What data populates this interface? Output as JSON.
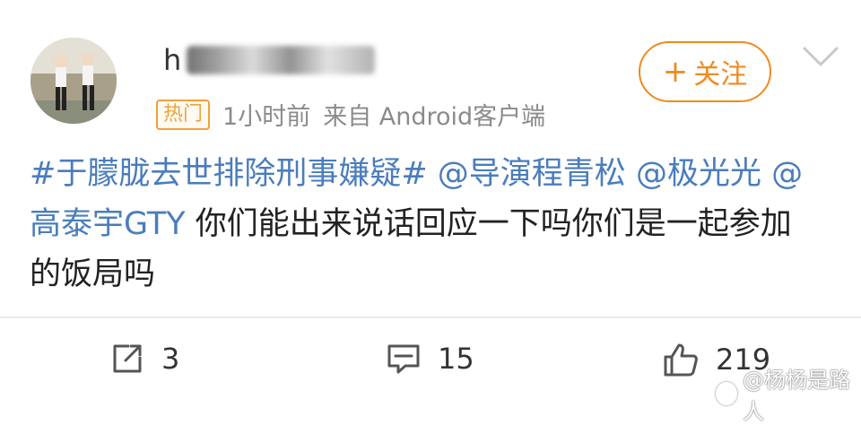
{
  "post": {
    "author_visible_prefix": "h",
    "badge": "热门",
    "time": "1小时前",
    "source": "来自 Android客户端",
    "follow_plus": "+",
    "follow_label": "关注",
    "content": [
      {
        "kind": "tag",
        "text": "#于朦胧去世排除刑事嫌疑#"
      },
      {
        "kind": "text",
        "text": " "
      },
      {
        "kind": "mention",
        "text": "@导演程青松"
      },
      {
        "kind": "text",
        "text": " "
      },
      {
        "kind": "mention",
        "text": "@极光光"
      },
      {
        "kind": "text",
        "text": " "
      },
      {
        "kind": "mention",
        "text": "@高泰宇GTY"
      },
      {
        "kind": "text",
        "text": " 你们能出来说话回应一下吗你们是一起参加的饭局吗"
      }
    ]
  },
  "actions": {
    "repost_count": "3",
    "comment_count": "15",
    "like_count": "219"
  },
  "watermark": {
    "text": "@杨杨是路人"
  },
  "colors": {
    "accent_orange": "#f08a1e",
    "link_blue": "#4a7dbd",
    "meta_gray": "#8b8b8b"
  }
}
